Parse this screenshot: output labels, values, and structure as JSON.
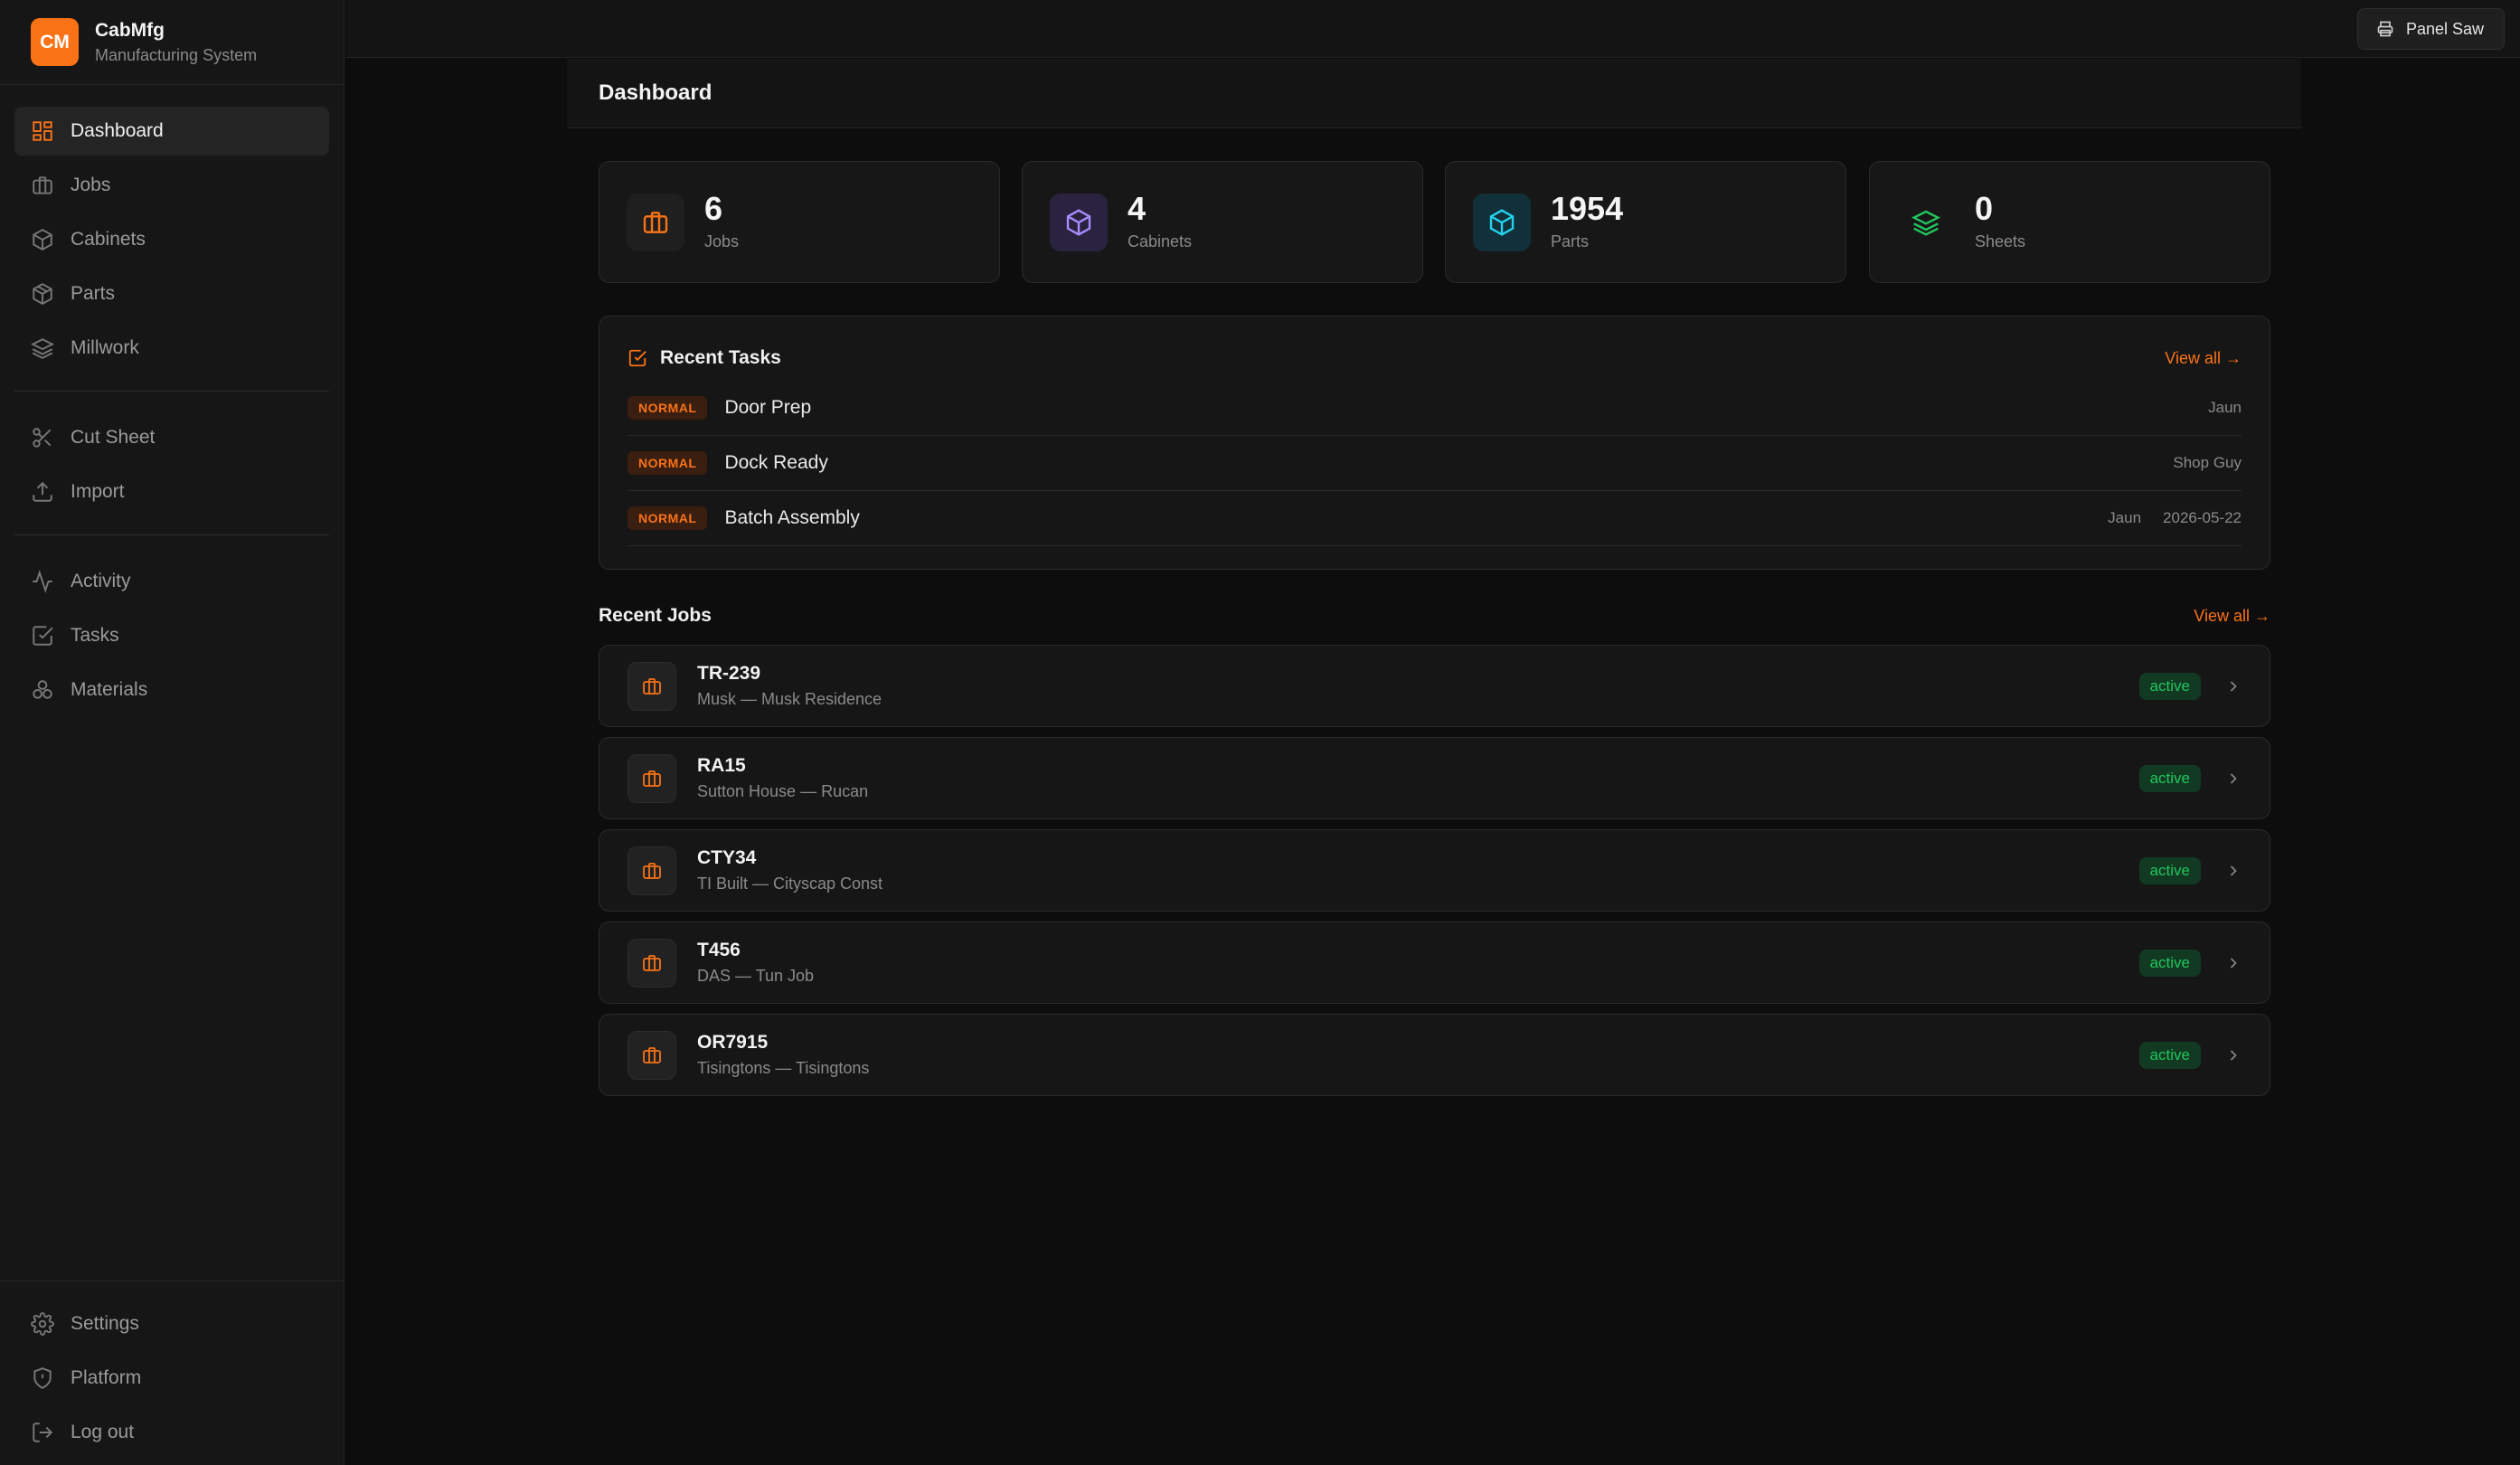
{
  "brand": {
    "logo_text": "CM",
    "name": "CabMfg",
    "subtitle": "Manufacturing System",
    "accent": "#f97316"
  },
  "sidebar": {
    "primary": [
      {
        "label": "Dashboard",
        "icon": "dashboard-icon",
        "active": true
      },
      {
        "label": "Jobs",
        "icon": "briefcase-icon"
      },
      {
        "label": "Cabinets",
        "icon": "box-icon"
      },
      {
        "label": "Parts",
        "icon": "package-icon"
      },
      {
        "label": "Millwork",
        "icon": "layers-icon"
      }
    ],
    "tools": [
      {
        "label": "Cut Sheet",
        "icon": "scissors-icon"
      },
      {
        "label": "Import",
        "icon": "upload-icon"
      }
    ],
    "records": [
      {
        "label": "Activity",
        "icon": "activity-icon"
      },
      {
        "label": "Tasks",
        "icon": "checkbox-icon"
      },
      {
        "label": "Materials",
        "icon": "materials-icon"
      }
    ],
    "bottom": [
      {
        "label": "Settings",
        "icon": "gear-icon"
      },
      {
        "label": "Platform",
        "icon": "shield-icon"
      },
      {
        "label": "Log out",
        "icon": "logout-icon"
      }
    ]
  },
  "topbar": {
    "station_button": "Panel Saw",
    "station_icon": "printer-icon"
  },
  "page": {
    "title": "Dashboard"
  },
  "stats": [
    {
      "value": "6",
      "label": "Jobs",
      "icon": "briefcase-icon",
      "color": "#f97316"
    },
    {
      "value": "4",
      "label": "Cabinets",
      "icon": "box-icon",
      "color": "#a78bfa"
    },
    {
      "value": "1954",
      "label": "Parts",
      "icon": "box-icon",
      "color": "#22d3ee"
    },
    {
      "value": "0",
      "label": "Sheets",
      "icon": "layers-icon",
      "color": "#22c55e"
    }
  ],
  "recent_tasks": {
    "title": "Recent Tasks",
    "view_all": "View all →",
    "items": [
      {
        "priority": "NORMAL",
        "name": "Door Prep",
        "assignee": "Jaun",
        "due": ""
      },
      {
        "priority": "NORMAL",
        "name": "Dock Ready",
        "assignee": "Shop Guy",
        "due": ""
      },
      {
        "priority": "NORMAL",
        "name": "Batch Assembly",
        "assignee": "Jaun",
        "due": "2026-05-22"
      }
    ]
  },
  "recent_jobs": {
    "title": "Recent Jobs",
    "view_all": "View all →",
    "items": [
      {
        "code": "TR-239",
        "subtitle": "Musk — Musk Residence",
        "status": "active"
      },
      {
        "code": "RA15",
        "subtitle": "Sutton House — Rucan",
        "status": "active"
      },
      {
        "code": "CTY34",
        "subtitle": "TI Built — Cityscap Const",
        "status": "active"
      },
      {
        "code": "T456",
        "subtitle": "DAS — Tun Job",
        "status": "active"
      },
      {
        "code": "OR7915",
        "subtitle": "Tisingtons — Tisingtons",
        "status": "active"
      }
    ]
  }
}
